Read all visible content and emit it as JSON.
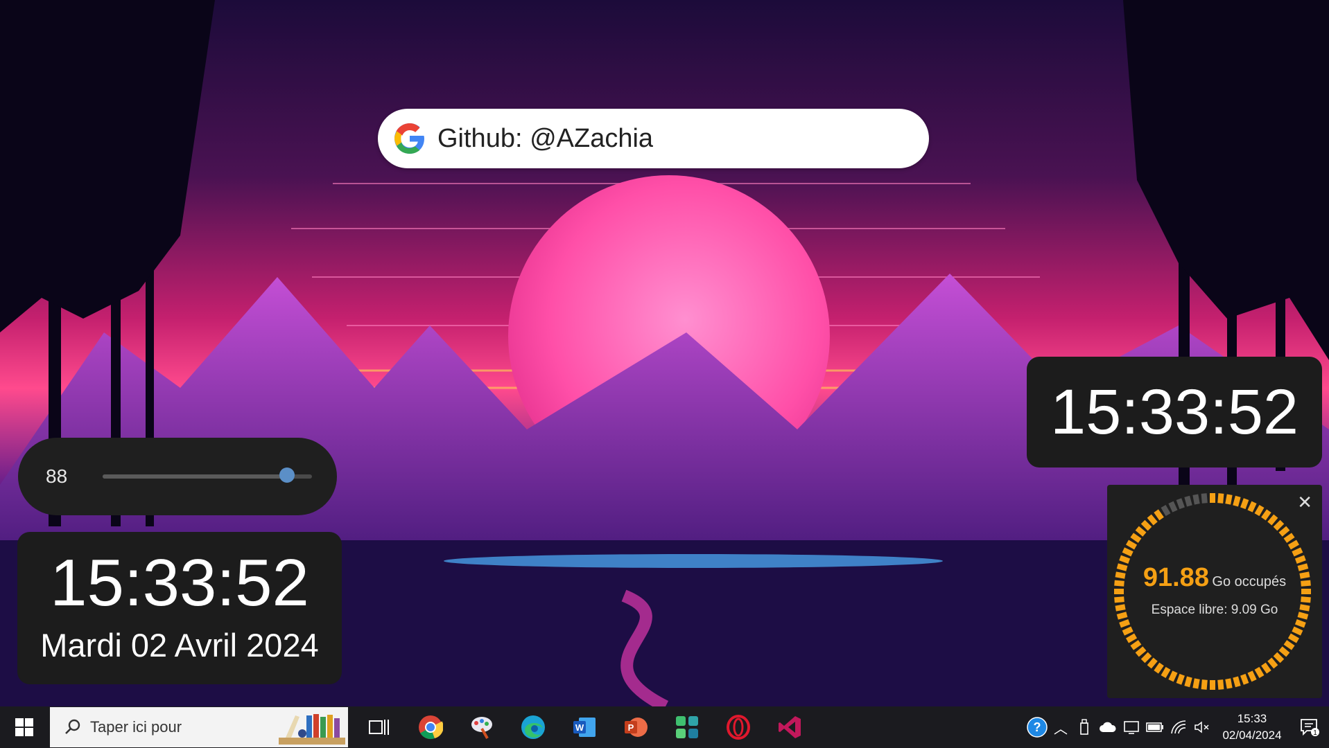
{
  "search_widget": {
    "text": "Github: @AZachia",
    "icon": "google-g-icon"
  },
  "volume_widget": {
    "value": "88",
    "level_percent": 88
  },
  "clock_left": {
    "time": "15:33:52",
    "date": "Mardi 02 Avril 2024"
  },
  "clock_right": {
    "time": "15:33:52"
  },
  "disk_widget": {
    "used_value": "91.88",
    "used_label": "Go occupés",
    "free_label": "Espace libre: 9.09 Go",
    "used_fraction": 0.91,
    "close_icon": "close-icon",
    "ring_color": "#f5a014"
  },
  "taskbar": {
    "search_placeholder": "Taper ici pour",
    "pinned": [
      "task-view",
      "chrome",
      "paint",
      "edge",
      "word",
      "powerpoint",
      "app",
      "opera",
      "visual-studio"
    ],
    "clock_time": "15:33",
    "clock_date": "02/04/2024",
    "notification_count": "1"
  }
}
